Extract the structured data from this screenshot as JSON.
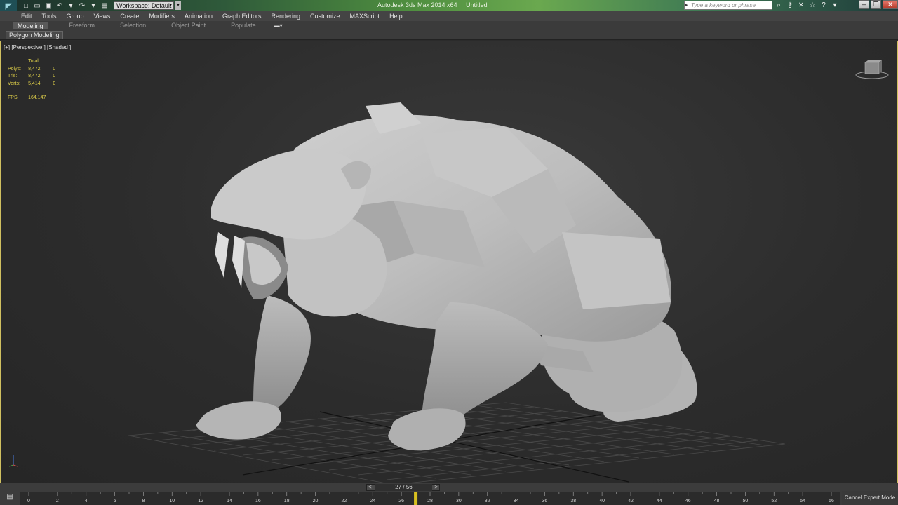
{
  "titlebar": {
    "workspace": "Workspace: Default",
    "app_name": "Autodesk 3ds Max  2014 x64",
    "doc_name": "Untitled",
    "search_placeholder": "Type a keyword or phrase"
  },
  "menu": [
    "Edit",
    "Tools",
    "Group",
    "Views",
    "Create",
    "Modifiers",
    "Animation",
    "Graph Editors",
    "Rendering",
    "Customize",
    "MAXScript",
    "Help"
  ],
  "ribbon": {
    "tabs": [
      "Modeling",
      "Freeform",
      "Selection",
      "Object Paint",
      "Populate"
    ],
    "active_tab": "Modeling",
    "sub_panel": "Polygon Modeling"
  },
  "viewport": {
    "label": "[+] [Perspective ] [Shaded ]",
    "stats": {
      "header": "Total",
      "rows": [
        {
          "label": "Polys:",
          "total": "8,472",
          "sel": "0"
        },
        {
          "label": "Tris:",
          "total": "8,472",
          "sel": "0"
        },
        {
          "label": "Verts:",
          "total": "5,414",
          "sel": "0"
        }
      ],
      "fps_label": "FPS:",
      "fps_value": "164.147"
    }
  },
  "timeline": {
    "prev": "<",
    "next": ">",
    "frame_display": "27 / 56",
    "current_frame": 27,
    "ticks": [
      "0",
      "2",
      "4",
      "6",
      "8",
      "10",
      "12",
      "14",
      "16",
      "18",
      "20",
      "22",
      "24",
      "26",
      "28",
      "30",
      "32",
      "34",
      "36",
      "38",
      "40",
      "42",
      "44",
      "46",
      "48",
      "50",
      "52",
      "54",
      "56"
    ]
  },
  "status": {
    "cancel_expert": "Cancel Expert Mode"
  },
  "colors": {
    "viewport_border": "#d0c060",
    "stats_text": "#e2d24a",
    "model_gray": "#b9b9b9"
  }
}
